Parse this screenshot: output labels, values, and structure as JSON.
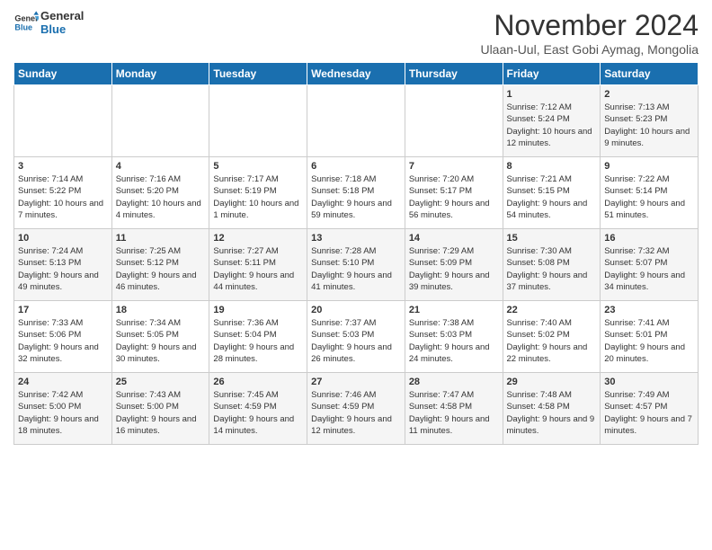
{
  "logo": {
    "line1": "General",
    "line2": "Blue"
  },
  "title": "November 2024",
  "subtitle": "Ulaan-Uul, East Gobi Aymag, Mongolia",
  "days_of_week": [
    "Sunday",
    "Monday",
    "Tuesday",
    "Wednesday",
    "Thursday",
    "Friday",
    "Saturday"
  ],
  "weeks": [
    [
      {
        "day": "",
        "info": ""
      },
      {
        "day": "",
        "info": ""
      },
      {
        "day": "",
        "info": ""
      },
      {
        "day": "",
        "info": ""
      },
      {
        "day": "",
        "info": ""
      },
      {
        "day": "1",
        "info": "Sunrise: 7:12 AM\nSunset: 5:24 PM\nDaylight: 10 hours and 12 minutes."
      },
      {
        "day": "2",
        "info": "Sunrise: 7:13 AM\nSunset: 5:23 PM\nDaylight: 10 hours and 9 minutes."
      }
    ],
    [
      {
        "day": "3",
        "info": "Sunrise: 7:14 AM\nSunset: 5:22 PM\nDaylight: 10 hours and 7 minutes."
      },
      {
        "day": "4",
        "info": "Sunrise: 7:16 AM\nSunset: 5:20 PM\nDaylight: 10 hours and 4 minutes."
      },
      {
        "day": "5",
        "info": "Sunrise: 7:17 AM\nSunset: 5:19 PM\nDaylight: 10 hours and 1 minute."
      },
      {
        "day": "6",
        "info": "Sunrise: 7:18 AM\nSunset: 5:18 PM\nDaylight: 9 hours and 59 minutes."
      },
      {
        "day": "7",
        "info": "Sunrise: 7:20 AM\nSunset: 5:17 PM\nDaylight: 9 hours and 56 minutes."
      },
      {
        "day": "8",
        "info": "Sunrise: 7:21 AM\nSunset: 5:15 PM\nDaylight: 9 hours and 54 minutes."
      },
      {
        "day": "9",
        "info": "Sunrise: 7:22 AM\nSunset: 5:14 PM\nDaylight: 9 hours and 51 minutes."
      }
    ],
    [
      {
        "day": "10",
        "info": "Sunrise: 7:24 AM\nSunset: 5:13 PM\nDaylight: 9 hours and 49 minutes."
      },
      {
        "day": "11",
        "info": "Sunrise: 7:25 AM\nSunset: 5:12 PM\nDaylight: 9 hours and 46 minutes."
      },
      {
        "day": "12",
        "info": "Sunrise: 7:27 AM\nSunset: 5:11 PM\nDaylight: 9 hours and 44 minutes."
      },
      {
        "day": "13",
        "info": "Sunrise: 7:28 AM\nSunset: 5:10 PM\nDaylight: 9 hours and 41 minutes."
      },
      {
        "day": "14",
        "info": "Sunrise: 7:29 AM\nSunset: 5:09 PM\nDaylight: 9 hours and 39 minutes."
      },
      {
        "day": "15",
        "info": "Sunrise: 7:30 AM\nSunset: 5:08 PM\nDaylight: 9 hours and 37 minutes."
      },
      {
        "day": "16",
        "info": "Sunrise: 7:32 AM\nSunset: 5:07 PM\nDaylight: 9 hours and 34 minutes."
      }
    ],
    [
      {
        "day": "17",
        "info": "Sunrise: 7:33 AM\nSunset: 5:06 PM\nDaylight: 9 hours and 32 minutes."
      },
      {
        "day": "18",
        "info": "Sunrise: 7:34 AM\nSunset: 5:05 PM\nDaylight: 9 hours and 30 minutes."
      },
      {
        "day": "19",
        "info": "Sunrise: 7:36 AM\nSunset: 5:04 PM\nDaylight: 9 hours and 28 minutes."
      },
      {
        "day": "20",
        "info": "Sunrise: 7:37 AM\nSunset: 5:03 PM\nDaylight: 9 hours and 26 minutes."
      },
      {
        "day": "21",
        "info": "Sunrise: 7:38 AM\nSunset: 5:03 PM\nDaylight: 9 hours and 24 minutes."
      },
      {
        "day": "22",
        "info": "Sunrise: 7:40 AM\nSunset: 5:02 PM\nDaylight: 9 hours and 22 minutes."
      },
      {
        "day": "23",
        "info": "Sunrise: 7:41 AM\nSunset: 5:01 PM\nDaylight: 9 hours and 20 minutes."
      }
    ],
    [
      {
        "day": "24",
        "info": "Sunrise: 7:42 AM\nSunset: 5:00 PM\nDaylight: 9 hours and 18 minutes."
      },
      {
        "day": "25",
        "info": "Sunrise: 7:43 AM\nSunset: 5:00 PM\nDaylight: 9 hours and 16 minutes."
      },
      {
        "day": "26",
        "info": "Sunrise: 7:45 AM\nSunset: 4:59 PM\nDaylight: 9 hours and 14 minutes."
      },
      {
        "day": "27",
        "info": "Sunrise: 7:46 AM\nSunset: 4:59 PM\nDaylight: 9 hours and 12 minutes."
      },
      {
        "day": "28",
        "info": "Sunrise: 7:47 AM\nSunset: 4:58 PM\nDaylight: 9 hours and 11 minutes."
      },
      {
        "day": "29",
        "info": "Sunrise: 7:48 AM\nSunset: 4:58 PM\nDaylight: 9 hours and 9 minutes."
      },
      {
        "day": "30",
        "info": "Sunrise: 7:49 AM\nSunset: 4:57 PM\nDaylight: 9 hours and 7 minutes."
      }
    ]
  ]
}
